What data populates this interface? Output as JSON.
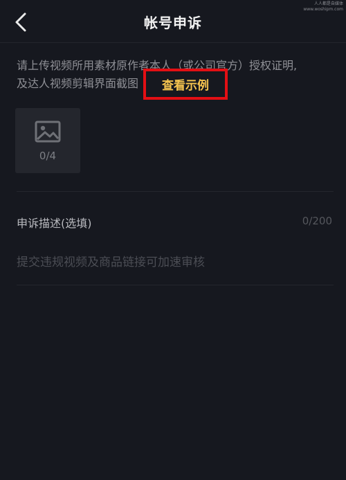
{
  "watermark": {
    "line1": "人人都是自媒体",
    "line2": "www.woshipm.com"
  },
  "header": {
    "title": "帐号申诉",
    "back_icon": "chevron-left-icon"
  },
  "instruction": {
    "line1": "请上传视频所用素材原作者本人（或公司官方）授权证明,",
    "line2": "及达人视频剪辑界面截图",
    "example_link": "查看示例",
    "highlight_color": "#e30f14",
    "link_color": "#f5c44f"
  },
  "upload": {
    "icon": "image-icon",
    "count": "0/4"
  },
  "description": {
    "label": "申诉描述(选填)",
    "count": "0/200",
    "placeholder": "提交违规视频及商品链接可加速审核"
  }
}
